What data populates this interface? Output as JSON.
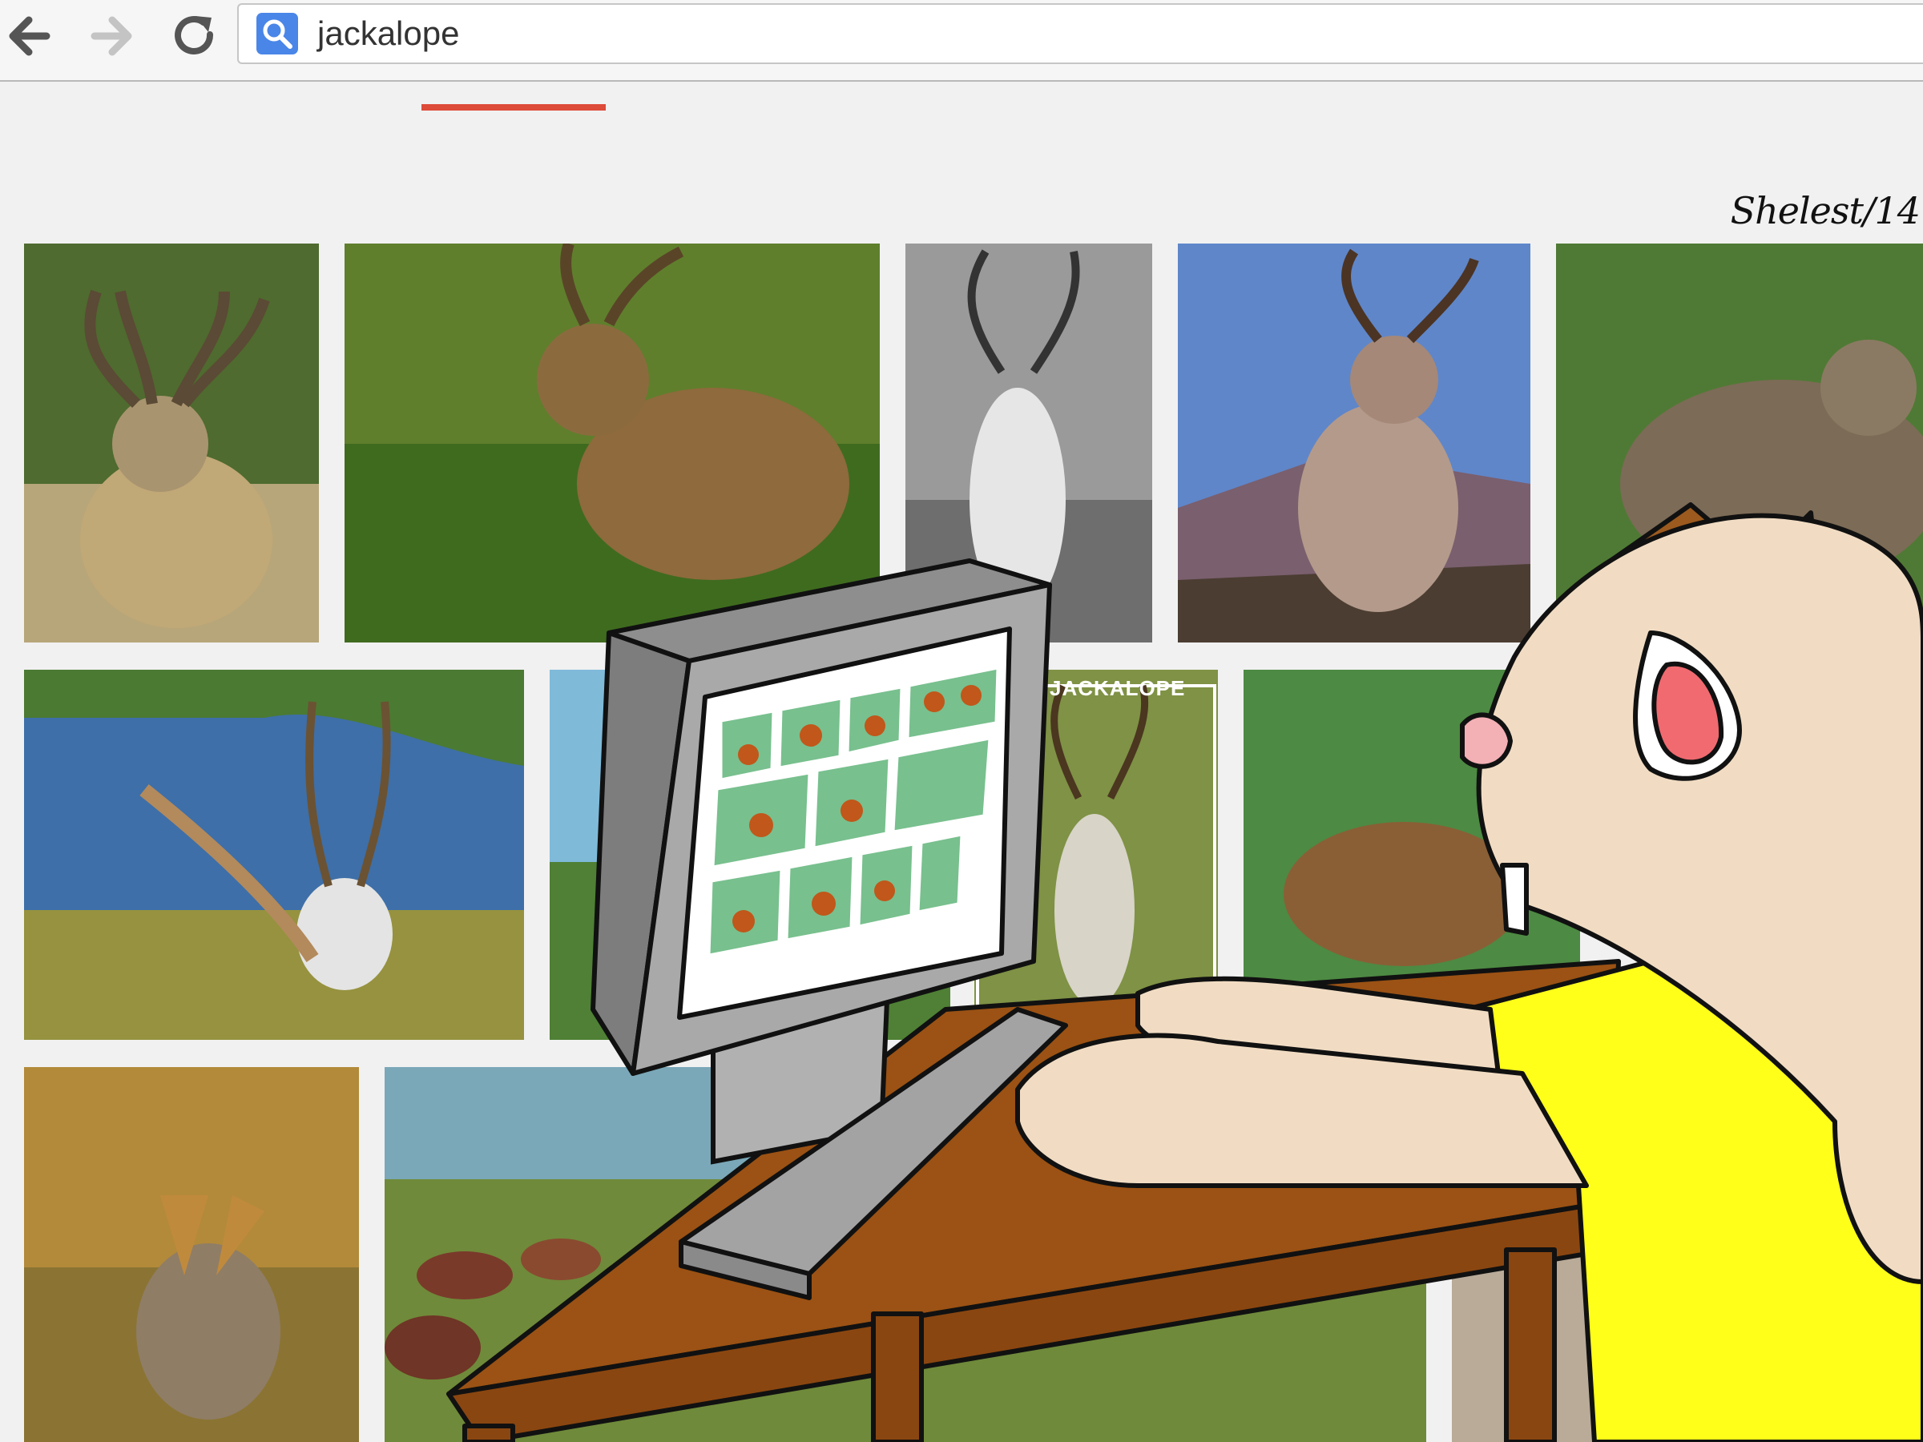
{
  "browser": {
    "query": "jackalope",
    "icons": {
      "back": "arrow-left-icon",
      "forward": "arrow-right-icon",
      "reload": "reload-icon",
      "search": "search-icon"
    }
  },
  "signature": "Shelest/14",
  "results": {
    "postcard_label": "JACKALOPE"
  },
  "colors": {
    "tab_indicator": "#dd4b39",
    "search_badge": "#4a86e8",
    "desk": "#9b5214",
    "shirt": "#ffff1a",
    "screen_tiles": "#78c08e"
  }
}
